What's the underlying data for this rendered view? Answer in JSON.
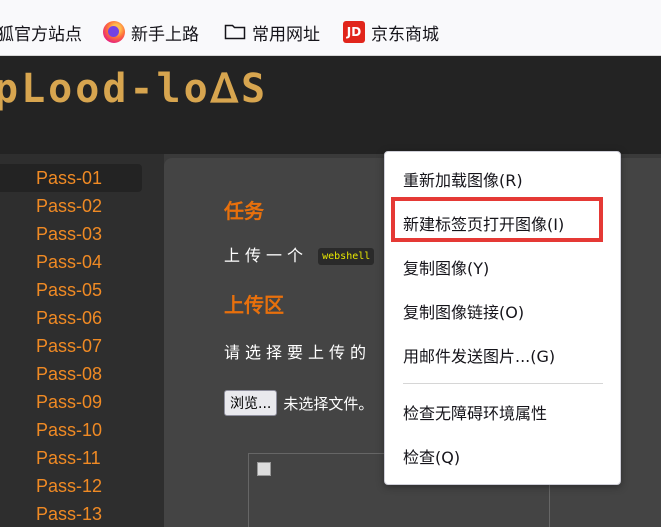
{
  "bookmarks": [
    {
      "label": "狐官方站点",
      "icon": "none"
    },
    {
      "label": "新手上路",
      "icon": "firefox-icon"
    },
    {
      "label": "常用网址",
      "icon": "folder-icon"
    },
    {
      "label": "京东商城",
      "icon": "jd-icon",
      "icon_text": "JD"
    }
  ],
  "header": {
    "logo": "pLood-loᐃS"
  },
  "sidebar": {
    "items": [
      "Pass-01",
      "Pass-02",
      "Pass-03",
      "Pass-04",
      "Pass-05",
      "Pass-06",
      "Pass-07",
      "Pass-08",
      "Pass-09",
      "Pass-10",
      "Pass-11",
      "Pass-12",
      "Pass-13"
    ],
    "active": "Pass-01"
  },
  "main": {
    "task_heading": "任务",
    "task_text": "上传一个",
    "code_label": "webshell",
    "upload_heading": "上传区",
    "upload_text": "请选择要上传的",
    "browse_label": "浏览...",
    "no_file_label": "未选择文件。"
  },
  "context_menu": {
    "items": [
      "重新加载图像(R)",
      "新建标签页打开图像(I)",
      "复制图像(Y)",
      "复制图像链接(O)",
      "用邮件发送图片...(G)",
      "检查无障碍环境属性",
      "检查(Q)"
    ],
    "highlighted": "新建标签页打开图像(I)"
  },
  "colors": {
    "accent": "#e8700c",
    "highlight_border": "#e53935",
    "logo": "#d7a54f"
  }
}
